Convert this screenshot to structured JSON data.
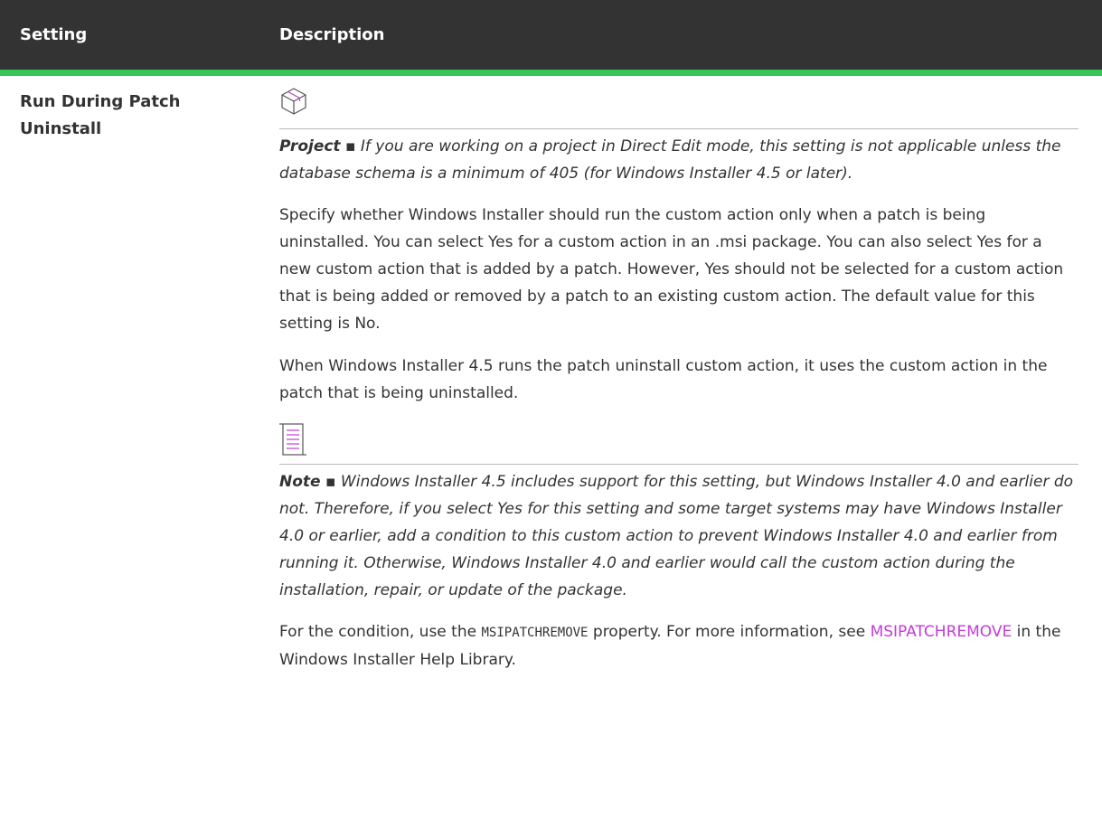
{
  "table": {
    "headers": {
      "setting": "Setting",
      "description": "Description"
    },
    "row": {
      "setting_name": "Run During Patch Uninstall",
      "project_callout": {
        "label": "Project",
        "separator": " ▪ ",
        "text": "If you are working on a project in Direct Edit mode, this setting is not applicable unless the database schema is a minimum of 405 (for Windows Installer 4.5 or later)."
      },
      "paragraph_1": "Specify whether Windows Installer should run the custom action only when a patch is being uninstalled. You can select Yes for a custom action in an .msi package. You can also select Yes for a new custom action that is added by a patch. However, Yes should not be selected for a custom action that is being added or removed by a patch to an existing custom action. The default value for this setting is No.",
      "paragraph_2": "When Windows Installer 4.5 runs the patch uninstall custom action, it uses the custom action in the patch that is being uninstalled.",
      "note_callout": {
        "label": "Note",
        "separator": " ▪ ",
        "text": "Windows Installer 4.5 includes support for this setting, but Windows Installer 4.0 and earlier do not. Therefore, if you select Yes for this setting and some target systems may have Windows Installer 4.0 or earlier, add a condition to this custom action to prevent Windows Installer 4.0 and earlier from running it. Otherwise, Windows Installer 4.0 and earlier would call the custom action during the installation, repair, or update of the package."
      },
      "paragraph_3": {
        "before_code": "For the condition, use the ",
        "code": "MSIPATCHREMOVE",
        "after_code": " property. For more information, see ",
        "link_text": "MSIPATCHREMOVE",
        "after_link": " in the Windows Installer Help Library."
      }
    }
  },
  "icons": {
    "project": "box-icon",
    "note": "note-icon"
  },
  "colors": {
    "header_bg": "#333333",
    "header_accent": "#35c65a",
    "link": "#c43bd9",
    "icon_accent": "#c43bd9"
  }
}
